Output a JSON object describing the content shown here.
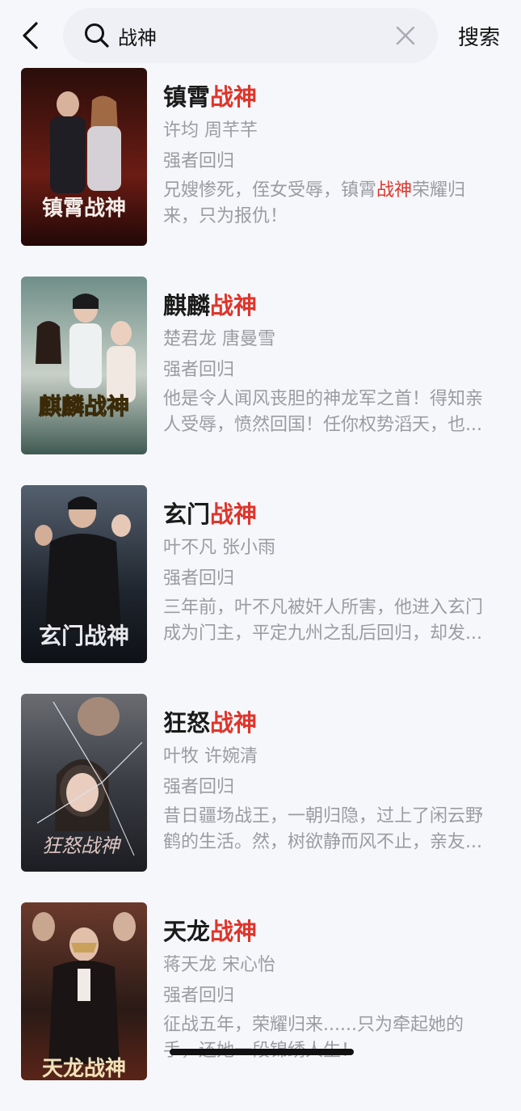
{
  "header": {
    "back_icon": "chevron-left-icon",
    "search_query": "战神",
    "search_button_label": "搜索"
  },
  "results": [
    {
      "title_prefix": "镇霄",
      "title_highlight": "战神",
      "cast": "许均  周芊芊",
      "genre": "强者回归",
      "desc_line1_a": "兄嫂惨死，侄女受辱，镇霄",
      "desc_line1_hl": "战神",
      "desc_line1_b": "荣耀归",
      "desc_line2": "来，只为报仇！",
      "poster_text": "镇霄战神",
      "poster_color": "#5a1a14"
    },
    {
      "title_prefix": "麒麟",
      "title_highlight": "战神",
      "cast": "楚君龙  唐曼雪",
      "genre": "强者回归",
      "desc_line1_a": "他是令人闻风丧胆的神龙军之首！得知亲",
      "desc_line1_hl": "",
      "desc_line1_b": "",
      "desc_line2": "人受辱，愤然回国！任你权势滔天，也...",
      "poster_text": "麒麟战神",
      "poster_color": "#4e6b63"
    },
    {
      "title_prefix": "玄门",
      "title_highlight": "战神",
      "cast": "叶不凡  张小雨",
      "genre": "强者回归",
      "desc_line1_a": "三年前，叶不凡被奸人所害，他进入玄门",
      "desc_line1_hl": "",
      "desc_line1_b": "",
      "desc_line2": "成为门主，平定九州之乱后回归，却发...",
      "poster_text": "玄门战神",
      "poster_color": "#2b3642"
    },
    {
      "title_prefix": "狂怒",
      "title_highlight": "战神",
      "cast": "叶牧  许婉清",
      "genre": "强者回归",
      "desc_line1_a": "昔日疆场战王，一朝归隐，过上了闲云野",
      "desc_line1_hl": "",
      "desc_line1_b": "",
      "desc_line2": "鹤的生活。然，树欲静而风不止，亲友...",
      "poster_text": "狂怒战神",
      "poster_color": "#3b3f48"
    },
    {
      "title_prefix": "天龙",
      "title_highlight": "战神",
      "cast": "蒋天龙  宋心怡",
      "genre": "强者回归",
      "desc_line1_a": "征战五年，荣耀归来......只为牵起她的",
      "desc_line1_hl": "",
      "desc_line1_b": "",
      "desc_line2": "手，还她一段锦绣人生！",
      "poster_text": "天龙战神",
      "poster_color": "#4a2a22"
    }
  ],
  "colors": {
    "accent": "#e0352b",
    "background": "#f6f7fb",
    "secondary_text": "#9a9ca2"
  }
}
